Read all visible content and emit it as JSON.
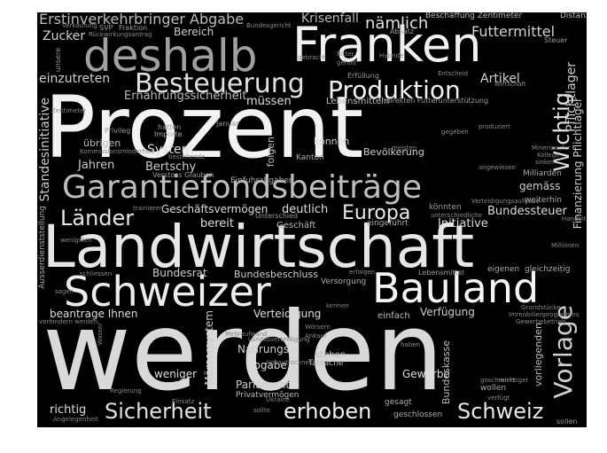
{
  "wordcloud": {
    "background_color": "#000000",
    "words": [
      {
        "text": "werden",
        "color": "#d9d9d9"
      },
      {
        "text": "Prozent",
        "color": "#f2f2f2"
      },
      {
        "text": "Landwirtschaft",
        "color": "#e6e6e6"
      },
      {
        "text": "Franken",
        "color": "#f0f0f0"
      },
      {
        "text": "deshalb",
        "color": "#a0a0a0"
      },
      {
        "text": "Schweizer",
        "color": "#ececec"
      },
      {
        "text": "Bauland",
        "color": "#f4f4f4"
      },
      {
        "text": "Garantiefondsbeiträge",
        "color": "#bdbdbd"
      },
      {
        "text": "Besteuerung",
        "color": "#e0e0e0"
      },
      {
        "text": "Produktion",
        "color": "#f2f2f2"
      },
      {
        "text": "Vorlage",
        "color": "#d0d0d0"
      },
      {
        "text": "Sicherheit",
        "color": "#e0e0e0"
      },
      {
        "text": "erhoben",
        "color": "#efefef"
      },
      {
        "text": "Schweiz",
        "color": "#e6e6e6"
      },
      {
        "text": "Länder",
        "color": "#e6e6e6"
      },
      {
        "text": "Europa",
        "color": "#eaeaea"
      },
      {
        "text": "Wichtig",
        "color": "#e0e0e0"
      },
      {
        "text": "Erstinverkehrbringer Abgabe",
        "color": "#bbbbbb"
      },
      {
        "text": "Krisenfall",
        "color": "#bbbbbb"
      },
      {
        "text": "nämlich",
        "color": "#e0e0e0"
      },
      {
        "text": "Futtermittel",
        "color": "#d0d0d0"
      },
      {
        "text": "Beschaffung Zentimeter",
        "color": "#bbbbbb"
      },
      {
        "text": "Distanz",
        "color": "#bbbbbb"
      },
      {
        "text": "Zucker",
        "color": "#d0d0d0"
      },
      {
        "text": "Bereich",
        "color": "#cccccc"
      },
      {
        "text": "Pflichtlager",
        "color": "#cccccc"
      },
      {
        "text": "einzutreten",
        "color": "#d0d0d0"
      },
      {
        "text": "Ernährungssicherheit",
        "color": "#bbbbbb"
      },
      {
        "text": "müssen",
        "color": "#dddddd"
      },
      {
        "text": "Artikel",
        "color": "#d0d0d0"
      },
      {
        "text": "Lebensmitteln",
        "color": "#bbbbbb"
      },
      {
        "text": "Standesinitiative",
        "color": "#cccccc"
      },
      {
        "text": "System",
        "color": "#dddddd"
      },
      {
        "text": "Jahren",
        "color": "#cccccc"
      },
      {
        "text": "Bertschy",
        "color": "#cccccc"
      },
      {
        "text": "übrigen",
        "color": "#bbbbbb"
      },
      {
        "text": "können",
        "color": "#cccccc"
      },
      {
        "text": "Bevölkerung",
        "color": "#cccccc"
      },
      {
        "text": "Kanton",
        "color": "#aaaaaa"
      },
      {
        "text": "Geschäftsvermögen",
        "color": "#dddddd"
      },
      {
        "text": "deutlich",
        "color": "#dddddd"
      },
      {
        "text": "Bundessteuer",
        "color": "#dddddd"
      },
      {
        "text": "gemäss",
        "color": "#cccccc"
      },
      {
        "text": "Finanzierung Pflichtlager",
        "color": "#cccccc"
      },
      {
        "text": "bereit",
        "color": "#dddddd"
      },
      {
        "text": "Geschäft",
        "color": "#bbbbbb"
      },
      {
        "text": "Initiative",
        "color": "#dddddd"
      },
      {
        "text": "Bundesrat",
        "color": "#cccccc"
      },
      {
        "text": "Bundesbeschluss",
        "color": "#cccccc"
      },
      {
        "text": "beantrage Ihnen",
        "color": "#dddddd"
      },
      {
        "text": "Verteidigung",
        "color": "#dddddd"
      },
      {
        "text": "einfach",
        "color": "#bbbbbb"
      },
      {
        "text": "Verfügung",
        "color": "#cccccc"
      },
      {
        "text": "Nahrungs",
        "color": "#cccccc"
      },
      {
        "text": "Abgabe",
        "color": "#dddddd"
      },
      {
        "text": "stehen",
        "color": "#bbbbbb"
      },
      {
        "text": "Tatsache",
        "color": "#bbbbbb"
      },
      {
        "text": "weniger",
        "color": "#dddddd"
      },
      {
        "text": "Parlament",
        "color": "#cccccc"
      },
      {
        "text": "Privatvermögen",
        "color": "#bbbbbb"
      },
      {
        "text": "Gewerbe",
        "color": "#dddddd"
      },
      {
        "text": "Bundeskasse",
        "color": "#bbbbbb"
      },
      {
        "text": "vorliegenden",
        "color": "#bbbbbb"
      },
      {
        "text": "Mörsersystem",
        "color": "#cccccc"
      },
      {
        "text": "richtig",
        "color": "#dddddd"
      },
      {
        "text": "wollen",
        "color": "#aaaaaa"
      },
      {
        "text": "gesagt",
        "color": "#aaaaaa"
      },
      {
        "text": "geschlossen",
        "color": "#aaaaaa"
      },
      {
        "text": "Ausserdienststellung",
        "color": "#aaaaaa"
      },
      {
        "text": "folgen",
        "color": "#bbbbbb"
      },
      {
        "text": "Milliarden",
        "color": "#aaaaaa"
      },
      {
        "text": "weiterhin",
        "color": "#aaaaaa"
      },
      {
        "text": "Einfuhrabgaben",
        "color": "#aaaaaa"
      },
      {
        "text": "eingeführt",
        "color": "#aaaaaa"
      },
      {
        "text": "Unterschied",
        "color": "#999999"
      },
      {
        "text": "könnten",
        "color": "#999999"
      },
      {
        "text": "eigenen",
        "color": "#aaaaaa"
      },
      {
        "text": "gleichzeitig",
        "color": "#aaaaaa"
      },
      {
        "text": "Versorgung",
        "color": "#aaaaaa"
      },
      {
        "text": "Lebensmittel",
        "color": "#999999"
      },
      {
        "text": "Januar",
        "color": "#999999"
      },
      {
        "text": "hatten",
        "color": "#999999"
      },
      {
        "text": "Importe",
        "color": "#aaaaaa"
      },
      {
        "text": "Privileg",
        "color": "#999999"
      },
      {
        "text": "Fraktion",
        "color": "#999999"
      },
      {
        "text": "SVP",
        "color": "#999999"
      },
      {
        "text": "Steuer",
        "color": "#999999"
      },
      {
        "text": "Absatz",
        "color": "#999999"
      },
      {
        "text": "Erfüllung",
        "color": "#999999"
      },
      {
        "text": "unsere",
        "color": "#999999"
      },
      {
        "text": "sollen",
        "color": "#999999"
      },
      {
        "text": "Ukraine",
        "color": "#888888"
      },
      {
        "text": "sollte",
        "color": "#888888"
      },
      {
        "text": "Regierung",
        "color": "#888888"
      },
      {
        "text": "Angelegenheit",
        "color": "#888888"
      },
      {
        "text": "Verstoss Glauben",
        "color": "#999999"
      },
      {
        "text": "Zentimeter",
        "color": "#888888"
      },
      {
        "text": "indirekten Futterunterstützung",
        "color": "#999999"
      },
      {
        "text": "Landesverteidigung",
        "color": "#888888"
      },
      {
        "text": "Mehraufwand",
        "color": "#888888"
      },
      {
        "text": "Grundstücke",
        "color": "#888888"
      },
      {
        "text": "Immobilienprogramms",
        "color": "#888888"
      },
      {
        "text": "Gewerbebetrieb",
        "color": "#888888"
      },
      {
        "text": "Verteidigungsaufgabe",
        "color": "#888888"
      },
      {
        "text": "Millionen",
        "color": "#888888"
      },
      {
        "text": "schliessen",
        "color": "#888888"
      },
      {
        "text": "wenigsten",
        "color": "#888888"
      },
      {
        "text": "trainieren",
        "color": "#888888"
      },
      {
        "text": "Handelt",
        "color": "#888888"
      },
      {
        "text": "unterschiedliche",
        "color": "#888888"
      },
      {
        "text": "erfolgen",
        "color": "#888888"
      },
      {
        "text": "kennen",
        "color": "#888888"
      },
      {
        "text": "haben",
        "color": "#888888"
      },
      {
        "text": "Ankauf",
        "color": "#888888"
      },
      {
        "text": "Wörsern",
        "color": "#888888"
      },
      {
        "text": "Anbautrocknet",
        "color": "#888888"
      },
      {
        "text": "wichtiger",
        "color": "#888888"
      },
      {
        "text": "geschmiert",
        "color": "#888888"
      },
      {
        "text": "verfügt",
        "color": "#888888"
      },
      {
        "text": "Wasser",
        "color": "#888888"
      },
      {
        "text": "sagen",
        "color": "#888888"
      },
      {
        "text": "Einsatz",
        "color": "#888888"
      },
      {
        "text": "verhindern werden",
        "color": "#888888"
      },
      {
        "text": "produziert",
        "color": "#888888"
      },
      {
        "text": "gegeben",
        "color": "#888888"
      },
      {
        "text": "meisten",
        "color": "#888888"
      },
      {
        "text": "angewiesen",
        "color": "#888888"
      },
      {
        "text": "Kommissionsminderheit",
        "color": "#888888"
      },
      {
        "text": "bestehende",
        "color": "#888888"
      },
      {
        "text": "Rückwirkungsantrag",
        "color": "#888888"
      },
      {
        "text": "Verkaufung",
        "color": "#888888"
      },
      {
        "text": "Bundesgericht",
        "color": "#888888"
      },
      {
        "text": "Ritter",
        "color": "#888888"
      },
      {
        "text": "geholt",
        "color": "#888888"
      },
      {
        "text": "gebracht",
        "color": "#888888"
      },
      {
        "text": "Entscheid",
        "color": "#888888"
      },
      {
        "text": "Wirtschaft",
        "color": "#888888"
      },
      {
        "text": "Hybride",
        "color": "#888888"
      },
      {
        "text": "Minenwerfer",
        "color": "#888888"
      },
      {
        "text": "Kollege",
        "color": "#888888"
      },
      {
        "text": "sinken",
        "color": "#888888"
      }
    ]
  }
}
